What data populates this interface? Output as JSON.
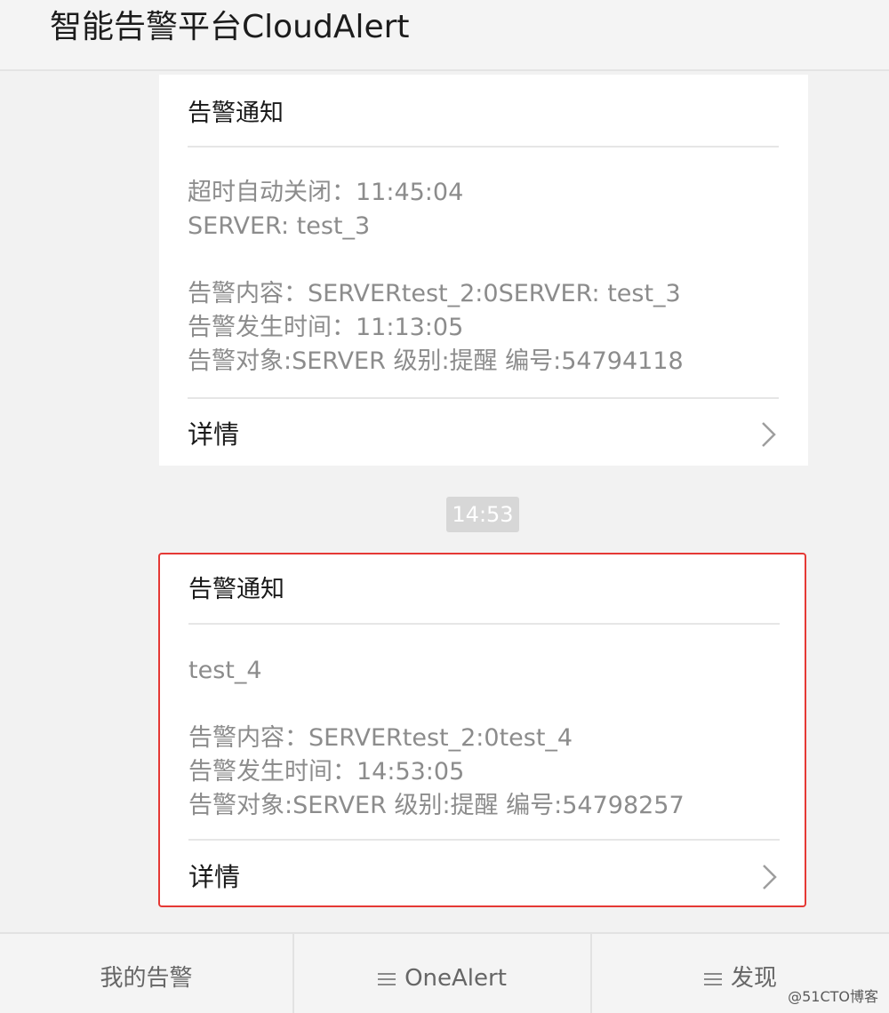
{
  "header": {
    "title": "智能告警平台CloudAlert"
  },
  "messages": [
    {
      "title": "告警通知",
      "lines": [
        "超时自动关闭：11:45:04",
        "SERVER: test_3",
        "",
        "告警内容：SERVERtest_2:0SERVER: test_3",
        "告警发生时间：11:13:05",
        "告警对象:SERVER 级别:提醒 编号:54794118"
      ],
      "detail_label": "详情"
    },
    {
      "title": "告警通知",
      "lines": [
        "test_4",
        "",
        "告警内容：SERVERtest_2:0test_4",
        "告警发生时间：14:53:05",
        "告警对象:SERVER 级别:提醒 编号:54798257"
      ],
      "detail_label": "详情",
      "highlight_color": "#e53935"
    }
  ],
  "time_separator": "14:53",
  "tabbar": {
    "tabs": [
      {
        "label": "我的告警",
        "icon": "none"
      },
      {
        "label": "OneAlert",
        "icon": "menu-icon"
      },
      {
        "label": "发现",
        "icon": "menu-icon"
      }
    ]
  },
  "watermark": "@51CTO博客"
}
